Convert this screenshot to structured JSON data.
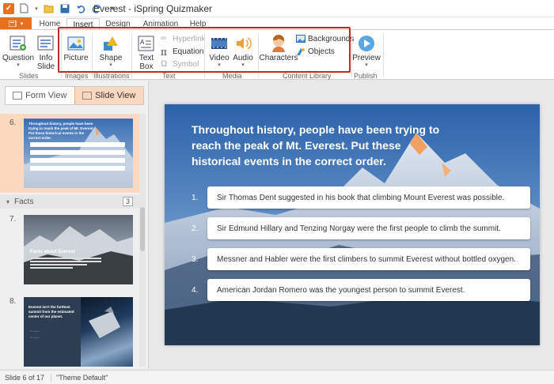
{
  "window": {
    "title": "Everest - iSpring Quizmaker"
  },
  "tabs": [
    {
      "label": "Home"
    },
    {
      "label": "Insert"
    },
    {
      "label": "Design"
    },
    {
      "label": "Animation"
    },
    {
      "label": "Help"
    }
  ],
  "active_tab": "Insert",
  "ribbon": {
    "question": "Question",
    "info_slide": "Info\nSlide",
    "picture": "Picture",
    "shape": "Shape",
    "text_box": "Text\nBox",
    "hyperlink": "Hyperlink",
    "equation": "Equation",
    "symbol": "Symbol",
    "video": "Video",
    "audio": "Audio",
    "characters": "Characters",
    "backgrounds": "Backgrounds",
    "objects": "Objects",
    "preview": "Preview",
    "groups": {
      "slides": "Slides",
      "images": "Images",
      "illustrations": "Illustrations",
      "text": "Text",
      "media": "Media",
      "content_library": "Content Library",
      "publish": "Publish"
    }
  },
  "left_panel": {
    "form_view": "Form View",
    "slide_view": "Slide View",
    "slides": [
      {
        "num": "6.",
        "title": "Throughout history, people have been trying to reach the peak of Mt. Everest. Put these historical events in the correct order."
      },
      {
        "num": "7.",
        "title": "Facts about Everest"
      },
      {
        "num": "8.",
        "title": "Everest isn't the furthest summit from the estimated center of our planet."
      }
    ],
    "section": {
      "label": "Facts",
      "count": "3"
    }
  },
  "slide": {
    "question": "Throughout history, people have been trying to reach the peak of Mt. Everest. Put these historical events in the correct order.",
    "answers": [
      {
        "num": "1.",
        "text": "Sir Thomas Dent suggested in his book that climbing Mount Everest was possible."
      },
      {
        "num": "2.",
        "text": "Sir Edmund Hillary and Tenzing Norgay were the first people to climb the summit."
      },
      {
        "num": "3.",
        "text": "Messner and Habler were the first climbers to summit Everest without bottled oxygen."
      },
      {
        "num": "4.",
        "text": "American Jordan Romero was the youngest person to summit Everest."
      }
    ]
  },
  "status": {
    "slide_pos": "Slide 6 of 17",
    "theme": "\"Theme Default\""
  },
  "colors": {
    "accent": "#e8711e",
    "highlight": "#c62828",
    "active_slide": "#fcd9bf"
  }
}
